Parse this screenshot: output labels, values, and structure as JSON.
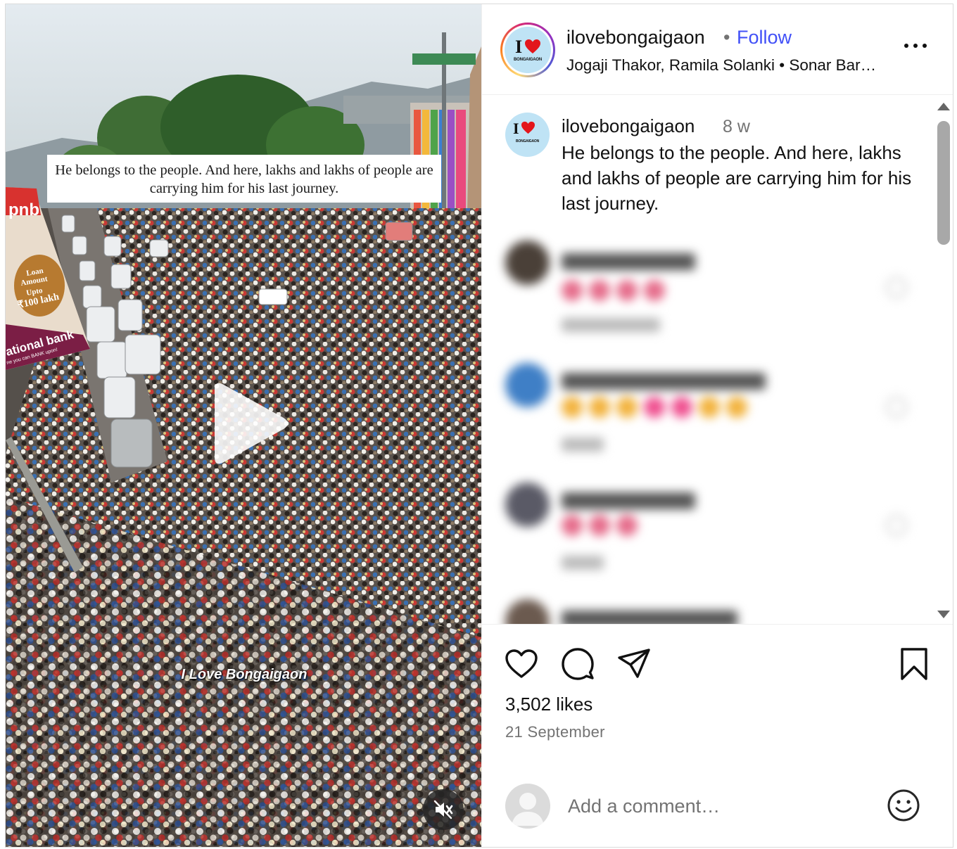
{
  "post": {
    "username": "ilovebongaigaon",
    "follow_label": "Follow",
    "separator_dot": "•",
    "audio_text": "Jogaji Thakor, Ramila Solanki • Sonar Bar…",
    "avatar_logo": {
      "letter": "I",
      "subtitle": "BONGAIGAON"
    },
    "more_icon": "more-horizontal-icon"
  },
  "media": {
    "caption_overlay": "He belongs to the people. And here, lakhs and lakhs of people are carrying him for his last journey.",
    "watermark": "I Love Bongaigaon",
    "billboard": {
      "brand": "pnb",
      "text1": "Loan",
      "text2": "Amount",
      "text3": "Upto",
      "amount": "₹100 lakh",
      "bank": "ational bank",
      "slogan": "ne you can BANK upon!"
    },
    "play_icon": "play-icon",
    "mute_icon": "muted-speaker-icon"
  },
  "caption": {
    "username": "ilovebongaigaon",
    "time": "8 w",
    "text": "He belongs to the people. And here, lakhs and lakhs of people are carrying him for his last journey."
  },
  "actions": {
    "like_icon": "heart-icon",
    "comment_icon": "comment-icon",
    "share_icon": "share-icon",
    "save_icon": "bookmark-icon"
  },
  "likes_text": "3,502 likes",
  "date_text": "21 September",
  "add_comment": {
    "placeholder": "Add a comment…",
    "emoji_icon": "emoji-icon"
  },
  "colors": {
    "follow": "#4150f7",
    "muted_text": "#737373",
    "border": "#dbdbdb"
  }
}
